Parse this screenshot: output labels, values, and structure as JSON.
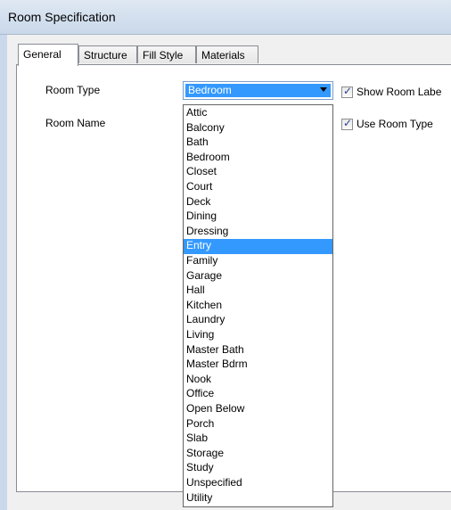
{
  "window": {
    "title": "Room Specification"
  },
  "tabs": [
    {
      "label": "General",
      "active": true
    },
    {
      "label": "Structure",
      "active": false
    },
    {
      "label": "Fill Style",
      "active": false
    },
    {
      "label": "Materials",
      "active": false
    }
  ],
  "form": {
    "room_type_label": "Room Type",
    "room_name_label": "Room Name",
    "room_type_value": "Bedroom",
    "show_room_label": {
      "label": "Show Room Labe",
      "checked": true
    },
    "use_room_type": {
      "label": "Use Room Type",
      "checked": true
    }
  },
  "dropdown": {
    "selected": "Entry",
    "options": [
      "Attic",
      "Balcony",
      "Bath",
      "Bedroom",
      "Closet",
      "Court",
      "Deck",
      "Dining",
      "Dressing",
      "Entry",
      "Family",
      "Garage",
      "Hall",
      "Kitchen",
      "Laundry",
      "Living",
      "Master Bath",
      "Master Bdrm",
      "Nook",
      "Office",
      "Open Below",
      "Porch",
      "Slab",
      "Storage",
      "Study",
      "Unspecified",
      "Utility"
    ]
  },
  "colors": {
    "selection": "#3399ff",
    "titlebar": "#c9d8ea"
  }
}
